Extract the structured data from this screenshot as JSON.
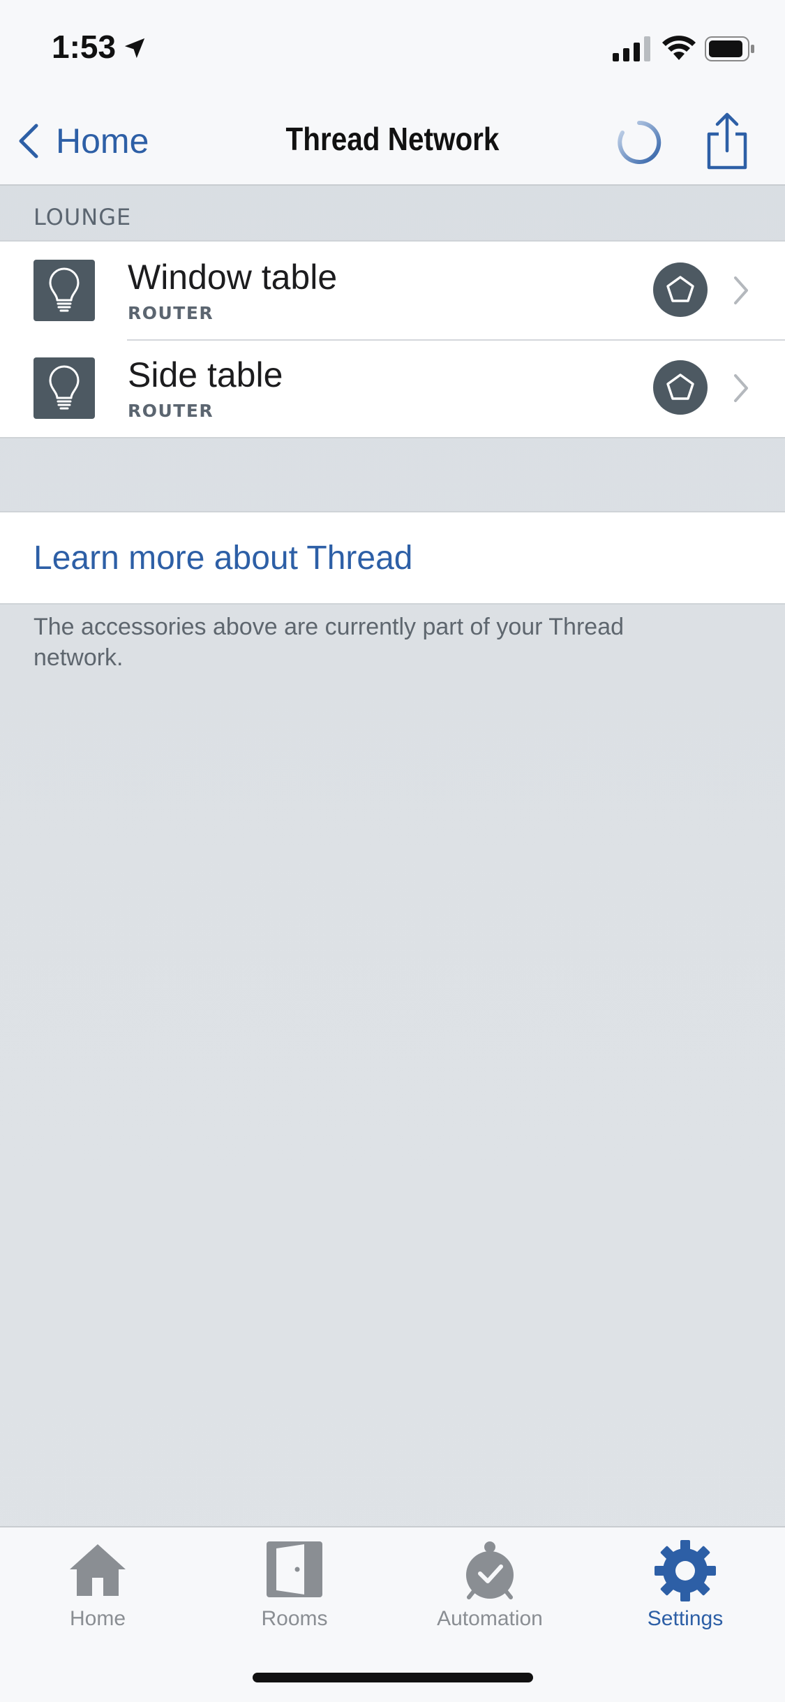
{
  "status_bar": {
    "time": "1:53"
  },
  "nav": {
    "back_label": "Home",
    "title": "Thread Network"
  },
  "section": {
    "header": "LOUNGE"
  },
  "accessories": [
    {
      "name": "Window table",
      "role": "ROUTER"
    },
    {
      "name": "Side table",
      "role": "ROUTER"
    }
  ],
  "learn_link": "Learn more about Thread",
  "footnote": "The accessories above are currently part of your Thread network.",
  "tabs": [
    {
      "label": "Home",
      "icon": "house-icon",
      "active": false
    },
    {
      "label": "Rooms",
      "icon": "door-icon",
      "active": false
    },
    {
      "label": "Automation",
      "icon": "clock-check-icon",
      "active": false
    },
    {
      "label": "Settings",
      "icon": "gear-icon",
      "active": true
    }
  ],
  "colors": {
    "accent": "#2d5fa6",
    "tile": "#4d5962",
    "inactive": "#8a8e93"
  }
}
